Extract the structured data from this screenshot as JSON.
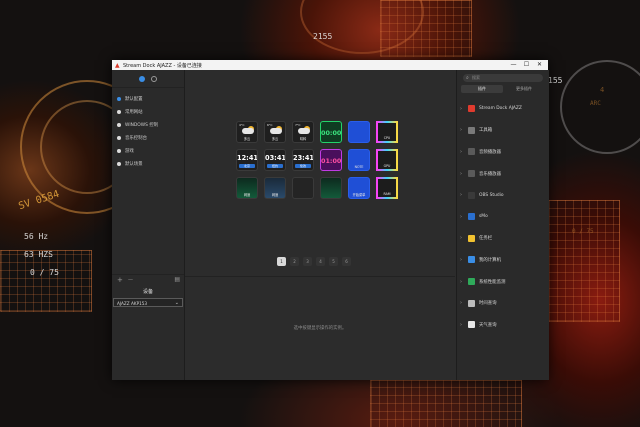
{
  "window": {
    "title": "Stream Dock AJAZZ - 设备已连接",
    "controls": [
      "—",
      "☐",
      "✕"
    ]
  },
  "wallpaper": {
    "hud_texts": [
      "2155",
      "155",
      "SV 0584",
      "56 Hz",
      "63 HZS",
      "0 / 75",
      "0 / 75",
      "ARC",
      "4"
    ]
  },
  "left_panel": {
    "profiles": [
      {
        "label": "默认配置"
      },
      {
        "label": "常用网站"
      },
      {
        "label": "WINDOWS 控制"
      },
      {
        "label": "音乐控制台"
      },
      {
        "label": "游戏"
      },
      {
        "label": "默认场景"
      }
    ],
    "add_label": "+",
    "remove_label": "—",
    "device_heading": "设备",
    "device_selected": "AJAZZ AKP153"
  },
  "keys": [
    {
      "type": "weather",
      "top": "4°C",
      "label": "多云"
    },
    {
      "type": "weather",
      "top": "6°C",
      "label": "多云"
    },
    {
      "type": "weather",
      "top": "7°C",
      "label": "晴转"
    },
    {
      "type": "timer",
      "time": "00:00"
    },
    {
      "type": "blue",
      "label": ""
    },
    {
      "type": "monitor",
      "label": "CPU"
    },
    {
      "type": "clock",
      "time": "12:41",
      "label": "北京"
    },
    {
      "type": "clock",
      "time": "03:41",
      "label": "纽约"
    },
    {
      "type": "clock",
      "time": "23:41",
      "label": "伦敦"
    },
    {
      "type": "timer2",
      "time": "01:00"
    },
    {
      "type": "blue",
      "label": "NOTE"
    },
    {
      "type": "monitor",
      "label": "GPU"
    },
    {
      "type": "graph",
      "label": "网速"
    },
    {
      "type": "graph2",
      "label": "网速"
    },
    {
      "type": "empty",
      "label": ""
    },
    {
      "type": "graph",
      "label": ""
    },
    {
      "type": "blue",
      "label": "开始菜单"
    },
    {
      "type": "monitor",
      "label": "RAM"
    }
  ],
  "pages": [
    "1",
    "2",
    "3",
    "4",
    "5",
    "6"
  ],
  "active_page": "1",
  "hint": "选中按键显示操作的实例。",
  "right_panel": {
    "search_placeholder": "搜索",
    "tabs": [
      "插件",
      "更多插件"
    ],
    "plugins": [
      {
        "label": "Stream Dock AJAZZ",
        "color": "#e03b2e"
      },
      {
        "label": "工具箱",
        "color": "#7a7a7a"
      },
      {
        "label": "音频播放器",
        "color": "#5a5a5a"
      },
      {
        "label": "音乐播放器",
        "color": "#5a5a5a"
      },
      {
        "label": "OBS Studio",
        "color": "#3a3a3a"
      },
      {
        "label": "sMo",
        "color": "#2a6fcf"
      },
      {
        "label": "任务栏",
        "color": "#f2c230"
      },
      {
        "label": "我的计算机",
        "color": "#3a8ee6"
      },
      {
        "label": "系统性能监测",
        "color": "#2faa5a"
      },
      {
        "label": "时间查询",
        "color": "#bcbcbc"
      },
      {
        "label": "天气查询",
        "color": "#e8e8e8"
      }
    ]
  }
}
